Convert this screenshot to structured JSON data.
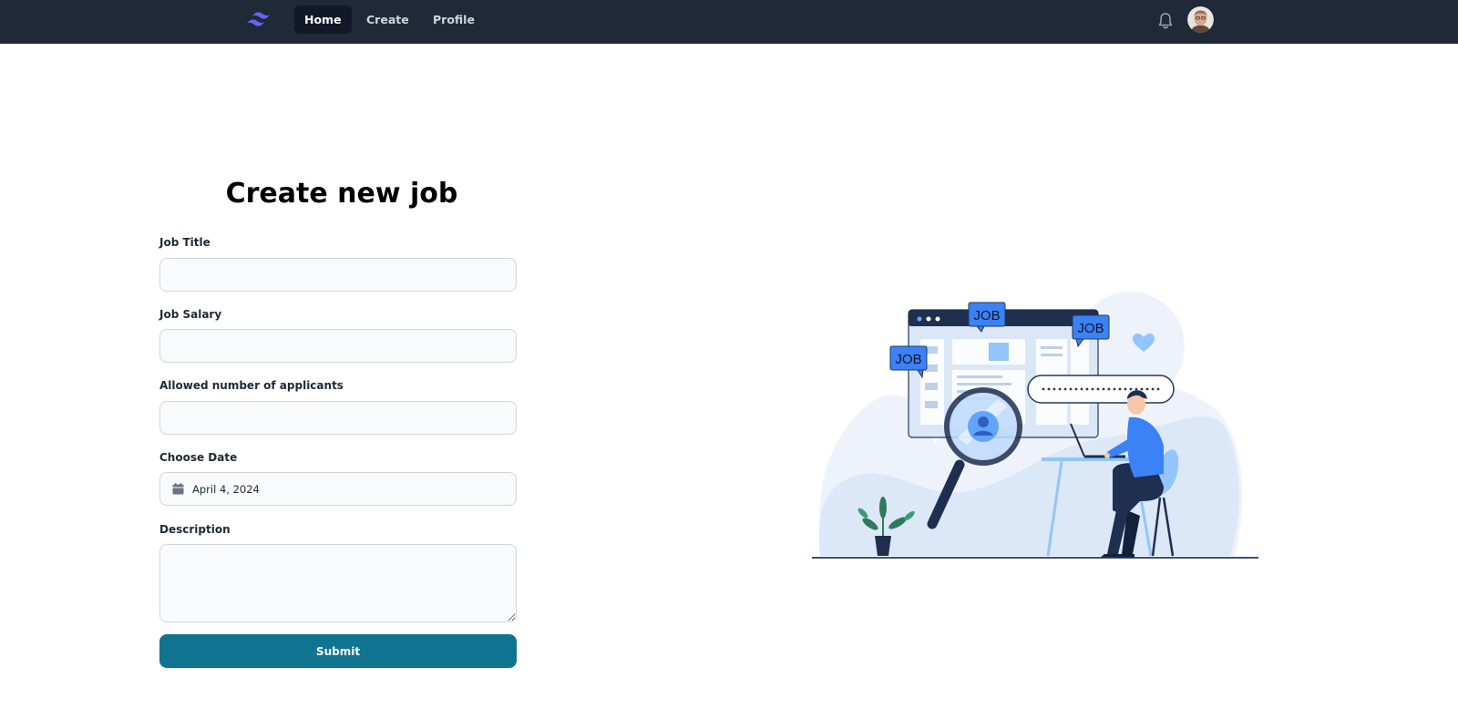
{
  "nav": {
    "links": [
      {
        "label": "Home",
        "active": true
      },
      {
        "label": "Create",
        "active": false
      },
      {
        "label": "Profile",
        "active": false
      }
    ]
  },
  "form": {
    "title": "Create new job",
    "job_title": {
      "label": "Job Title",
      "value": ""
    },
    "job_salary": {
      "label": "Job Salary",
      "value": ""
    },
    "applicants": {
      "label": "Allowed number of applicants",
      "value": ""
    },
    "date": {
      "label": "Choose Date",
      "value": "April 4, 2024"
    },
    "description": {
      "label": "Description",
      "value": ""
    },
    "submit_label": "Submit"
  },
  "illustration": {
    "tags": [
      "JOB",
      "JOB",
      "JOB"
    ]
  },
  "colors": {
    "navbar_bg": "#1f2937",
    "accent": "#0e7490",
    "illustration_blue": "#3b82f6"
  },
  "icons": [
    "tailwind-logo-icon",
    "bell-icon",
    "calendar-icon"
  ]
}
